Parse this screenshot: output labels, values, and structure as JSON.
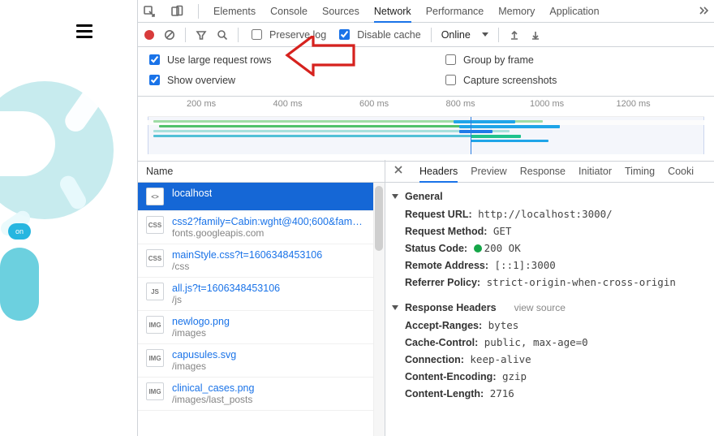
{
  "top_tabs": {
    "items": [
      "Elements",
      "Console",
      "Sources",
      "Network",
      "Performance",
      "Memory",
      "Application"
    ],
    "active_index": 3
  },
  "toolbar": {
    "preserve_log_label": "Preserve log",
    "preserve_log_checked": false,
    "disable_cache_label": "Disable cache",
    "disable_cache_checked": true,
    "throttling_value": "Online"
  },
  "settings": {
    "large_rows_label": "Use large request rows",
    "large_rows_checked": true,
    "show_overview_label": "Show overview",
    "show_overview_checked": true,
    "group_by_frame_label": "Group by frame",
    "group_by_frame_checked": false,
    "capture_screenshots_label": "Capture screenshots",
    "capture_screenshots_checked": false
  },
  "ruler_ticks": [
    "200 ms",
    "400 ms",
    "600 ms",
    "800 ms",
    "1000 ms",
    "1200 ms"
  ],
  "list_header": {
    "name_label": "Name"
  },
  "requests": [
    {
      "name": "localhost",
      "sub": "",
      "icon": "<>",
      "selected": true
    },
    {
      "name": "css2?family=Cabin:wght@400;600&family=.",
      "sub": "fonts.googleapis.com",
      "icon": "CSS"
    },
    {
      "name": "mainStyle.css?t=1606348453106",
      "sub": "/css",
      "icon": "CSS"
    },
    {
      "name": "all.js?t=1606348453106",
      "sub": "/js",
      "icon": "JS"
    },
    {
      "name": "newlogo.png",
      "sub": "/images",
      "icon": "IMG"
    },
    {
      "name": "capusules.svg",
      "sub": "/images",
      "icon": "IMG"
    },
    {
      "name": "clinical_cases.png",
      "sub": "/images/last_posts",
      "icon": "IMG"
    }
  ],
  "detail_tabs": {
    "items": [
      "Headers",
      "Preview",
      "Response",
      "Initiator",
      "Timing",
      "Cooki"
    ],
    "active_index": 0
  },
  "headers": {
    "general_label": "General",
    "general": [
      {
        "k": "Request URL:",
        "v": "http://localhost:3000/"
      },
      {
        "k": "Request Method:",
        "v": "GET"
      },
      {
        "k": "Status Code:",
        "v": "200 OK",
        "status": true
      },
      {
        "k": "Remote Address:",
        "v": "[::1]:3000"
      },
      {
        "k": "Referrer Policy:",
        "v": "strict-origin-when-cross-origin"
      }
    ],
    "response_label": "Response Headers",
    "view_source_label": "view source",
    "response": [
      {
        "k": "Accept-Ranges:",
        "v": "bytes"
      },
      {
        "k": "Cache-Control:",
        "v": "public, max-age=0"
      },
      {
        "k": "Connection:",
        "v": "keep-alive"
      },
      {
        "k": "Content-Encoding:",
        "v": "gzip"
      },
      {
        "k": "Content-Length:",
        "v": "2716"
      }
    ]
  },
  "badge_on": "on"
}
